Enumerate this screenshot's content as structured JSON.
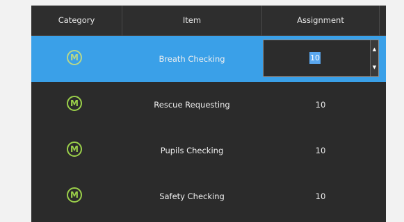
{
  "table": {
    "columns": [
      "Category",
      "Item",
      "Assignment"
    ],
    "rows": [
      {
        "category_icon": "M",
        "item": "Breath Checking",
        "assignment": "10",
        "selected": true
      },
      {
        "category_icon": "M",
        "item": "Rescue Requesting",
        "assignment": "10",
        "selected": false
      },
      {
        "category_icon": "M",
        "item": "Pupils Checking",
        "assignment": "10",
        "selected": false
      },
      {
        "category_icon": "M",
        "item": "Safety Checking",
        "assignment": "10",
        "selected": false
      }
    ],
    "editor": {
      "value": "10",
      "spin_up_glyph": "▲",
      "spin_down_glyph": "▼"
    }
  },
  "colors": {
    "selected_row": "#3aa0e8",
    "badge": "#9bd04a",
    "background": "#2b2b2b"
  }
}
